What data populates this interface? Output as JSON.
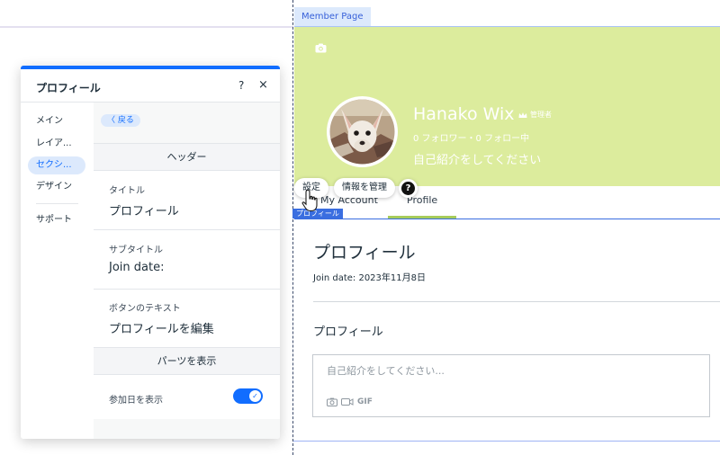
{
  "canvas": {
    "member_page_tag": "Member Page",
    "section_tag": "プロフィール"
  },
  "profile_header": {
    "username": "Hanako Wix",
    "admin_badge": "管理者",
    "follow_counts": "0 フォロワー・0 フォロー中",
    "bio": "自己紹介をしてください",
    "cover_color": "#dcec9d"
  },
  "floating_toolbar": {
    "settings_label": "設定",
    "manage_info_label": "情報を管理",
    "help_label": "?"
  },
  "profile_tabs": [
    {
      "label": "My Account"
    },
    {
      "label": "Profile",
      "active": true
    }
  ],
  "profile_content": {
    "title": "プロフィール",
    "join_date": "Join date: 2023年11月8日",
    "section_heading": "プロフィール",
    "bio_placeholder": "自己紹介をしてください...",
    "gif_label": "GIF"
  },
  "panel": {
    "title": "プロフィール",
    "help_label": "?",
    "close_label": "×",
    "nav": [
      {
        "label": "メイン"
      },
      {
        "label": "レイア..."
      },
      {
        "label": "セクシ...",
        "active": true
      },
      {
        "label": "デザイン"
      },
      {
        "label": "サポート"
      }
    ],
    "back_label": "〈  戻る",
    "header_section": "ヘッダー",
    "fields": [
      {
        "label": "タイトル",
        "value": "プロフィール"
      },
      {
        "label": "サブタイトル",
        "value": "Join date:"
      },
      {
        "label": "ボタンのテキスト",
        "value": "プロフィールを編集"
      }
    ],
    "parts_section": "パーツを表示",
    "join_date_toggle": {
      "label": "参加日を表示",
      "on": true,
      "check": "✓"
    }
  },
  "colors": {
    "accent": "#116dff",
    "tab_underline": "#a7cc5b"
  }
}
